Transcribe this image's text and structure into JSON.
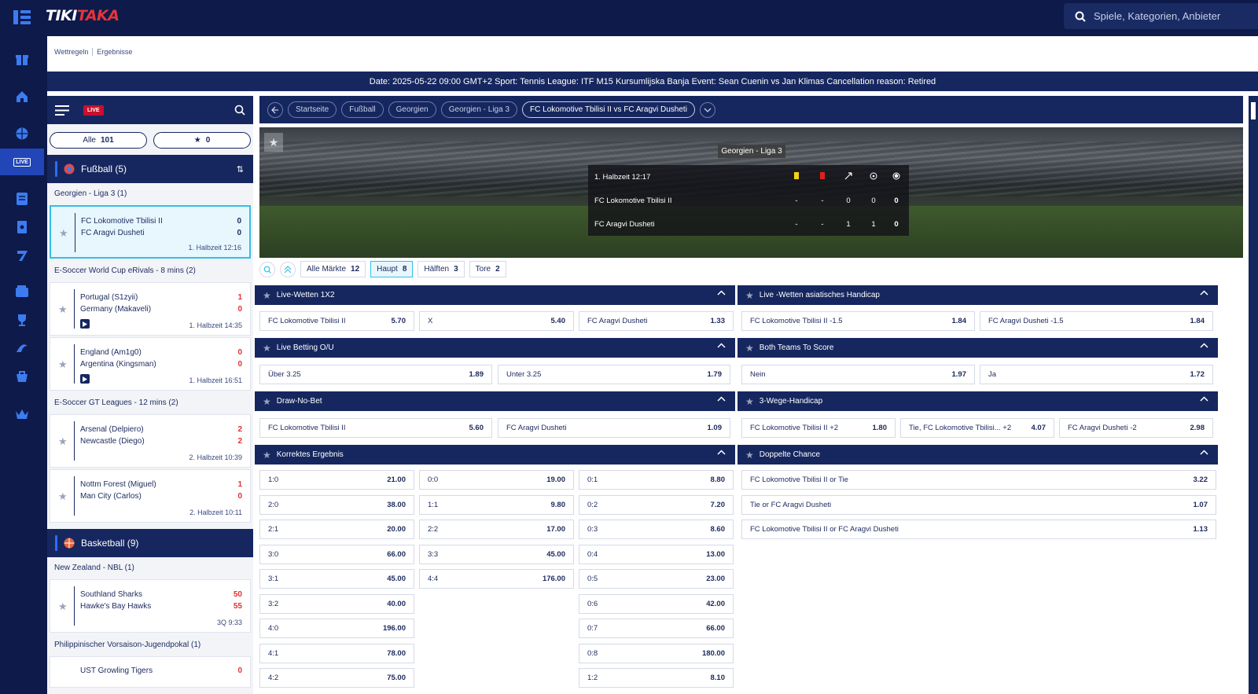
{
  "app": {
    "logo_part1": "TIKI",
    "logo_part2": "TAKA",
    "search_placeholder": "Spiele, Kategorien, Anbieter"
  },
  "rail": {
    "icons": [
      "gift-icon",
      "home-icon",
      "sports-ball-icon",
      "live-icon",
      "betslip-icon",
      "coupon-icon",
      "seven-icon",
      "wallet-icon",
      "trophy-icon",
      "promo-icon",
      "shop-icon",
      "crown-icon"
    ],
    "live_label": "LIVE"
  },
  "breadcrumbs": [
    "Wettregeln",
    "Ergebnisse"
  ],
  "notice": "Date: 2025-05-22 09:00 GMT+2 Sport: Tennis League: ITF M15 Kursumlijska Banja Event: Sean Cuenin vs Jan Klimas Cancellation reason: Retired",
  "sidebar": {
    "live_badge": "LIVE",
    "filter_all": "Alle",
    "filter_all_count": "101",
    "filter_fav_count": "0",
    "sports": [
      {
        "name": "Fußball (5)"
      },
      {
        "name": "Basketball (9)"
      }
    ],
    "leagues": [
      "Georgien - Liga 3  (1)",
      "E-Soccer World Cup eRivals - 8 mins  (2)",
      "E-Soccer GT Leagues - 12 mins  (2)",
      "New Zealand - NBL  (1)",
      "Philippinischer Vorsaison-Jugendpokal  (1)"
    ],
    "matches": [
      {
        "home": "FC Lokomotive Tbilisi II",
        "away": "FC Aragvi Dusheti",
        "hs": "0",
        "as": "0",
        "time": "1. Halbzeit 12:16"
      },
      {
        "home": "Portugal (S1zyii)",
        "away": "Germany (Makaveli)",
        "hs": "1",
        "as": "0",
        "time": "1. Halbzeit 14:35"
      },
      {
        "home": "England (Am1g0)",
        "away": "Argentina (Kingsman)",
        "hs": "0",
        "as": "0",
        "time": "1. Halbzeit 16:51"
      },
      {
        "home": "Arsenal (Delpiero)",
        "away": "Newcastle (Diego)",
        "hs": "2",
        "as": "2",
        "time": "2. Halbzeit 10:39"
      },
      {
        "home": "Nottm Forest (Miguel)",
        "away": "Man City (Carlos)",
        "hs": "1",
        "as": "0",
        "time": "2. Halbzeit 10:11"
      },
      {
        "home": "Southland Sharks",
        "away": "Hawke's Bay Hawks",
        "hs": "50",
        "as": "55",
        "time": "3Q 9:33"
      },
      {
        "home": "UST Growling Tigers",
        "away": "",
        "hs": "0",
        "as": "",
        "time": ""
      }
    ]
  },
  "nav": {
    "chips": [
      "Startseite",
      "Fußball",
      "Georgien",
      "Georgien - Liga 3",
      "FC Lokomotive Tbilisi II vs FC Aragvi Dusheti"
    ]
  },
  "scoreboard": {
    "league": "Georgien - Liga 3",
    "period": "1. Halbzeit 12:17",
    "home": {
      "name": "FC Lokomotive Tbilisi II",
      "yc": "-",
      "rc": "-",
      "c": "0",
      "p": "0",
      "g": "0"
    },
    "away": {
      "name": "FC Aragvi Dusheti",
      "yc": "-",
      "rc": "-",
      "c": "1",
      "p": "1",
      "g": "0"
    }
  },
  "tabs": [
    {
      "label": "Alle Märkte",
      "count": "12"
    },
    {
      "label": "Haupt",
      "count": "8"
    },
    {
      "label": "Hälften",
      "count": "3"
    },
    {
      "label": "Tore",
      "count": "2"
    }
  ],
  "markets": {
    "m1x2": {
      "title": "Live-Wetten 1X2",
      "odds": [
        [
          "FC Lokomotive Tbilisi II",
          "5.70"
        ],
        [
          "X",
          "5.40"
        ],
        [
          "FC Aragvi Dusheti",
          "1.33"
        ]
      ]
    },
    "ahc": {
      "title": "Live -Wetten asiatisches Handicap",
      "odds": [
        [
          "FC Lokomotive Tbilisi II -1.5",
          "1.84"
        ],
        [
          "FC Aragvi Dusheti -1.5",
          "1.84"
        ]
      ]
    },
    "ou": {
      "title": "Live Betting O/U",
      "odds": [
        [
          "Über 3.25",
          "1.89"
        ],
        [
          "Unter 3.25",
          "1.79"
        ]
      ]
    },
    "btts": {
      "title": "Both Teams To Score",
      "odds": [
        [
          "Nein",
          "1.97"
        ],
        [
          "Ja",
          "1.72"
        ]
      ]
    },
    "dnb": {
      "title": "Draw-No-Bet",
      "odds": [
        [
          "FC Lokomotive Tbilisi II",
          "5.60"
        ],
        [
          "FC Aragvi Dusheti",
          "1.09"
        ]
      ]
    },
    "hc3": {
      "title": "3-Wege-Handicap",
      "odds": [
        [
          "FC Lokomotive Tbilisi II  +2",
          "1.80"
        ],
        [
          "Tie, FC Lokomotive Tbilisi...  +2",
          "4.07"
        ],
        [
          "FC Aragvi Dusheti  -2",
          "2.98"
        ]
      ]
    },
    "cs": {
      "title": "Korrektes Ergebnis",
      "col1": [
        [
          "1:0",
          "21.00"
        ],
        [
          "2:0",
          "38.00"
        ],
        [
          "2:1",
          "20.00"
        ],
        [
          "3:0",
          "66.00"
        ],
        [
          "3:1",
          "45.00"
        ],
        [
          "3:2",
          "40.00"
        ],
        [
          "4:0",
          "196.00"
        ],
        [
          "4:1",
          "78.00"
        ],
        [
          "4:2",
          "75.00"
        ]
      ],
      "col2": [
        [
          "0:0",
          "19.00"
        ],
        [
          "1:1",
          "9.80"
        ],
        [
          "2:2",
          "17.00"
        ],
        [
          "3:3",
          "45.00"
        ],
        [
          "4:4",
          "176.00"
        ]
      ],
      "col3": [
        [
          "0:1",
          "8.80"
        ],
        [
          "0:2",
          "7.20"
        ],
        [
          "0:3",
          "8.60"
        ],
        [
          "0:4",
          "13.00"
        ],
        [
          "0:5",
          "23.00"
        ],
        [
          "0:6",
          "42.00"
        ],
        [
          "0:7",
          "66.00"
        ],
        [
          "0:8",
          "180.00"
        ],
        [
          "1:2",
          "8.10"
        ]
      ]
    },
    "dc": {
      "title": "Doppelte Chance",
      "odds": [
        [
          "FC Lokomotive Tbilisi II or Tie",
          "3.22"
        ],
        [
          "Tie or FC Aragvi Dusheti",
          "1.07"
        ],
        [
          "FC Lokomotive Tbilisi II or FC Aragvi Dusheti",
          "1.13"
        ]
      ]
    }
  },
  "colors": {
    "navy": "#16275f",
    "bg": "#0d1a4a",
    "accent": "#33bfe8",
    "live": "#c8102e"
  }
}
